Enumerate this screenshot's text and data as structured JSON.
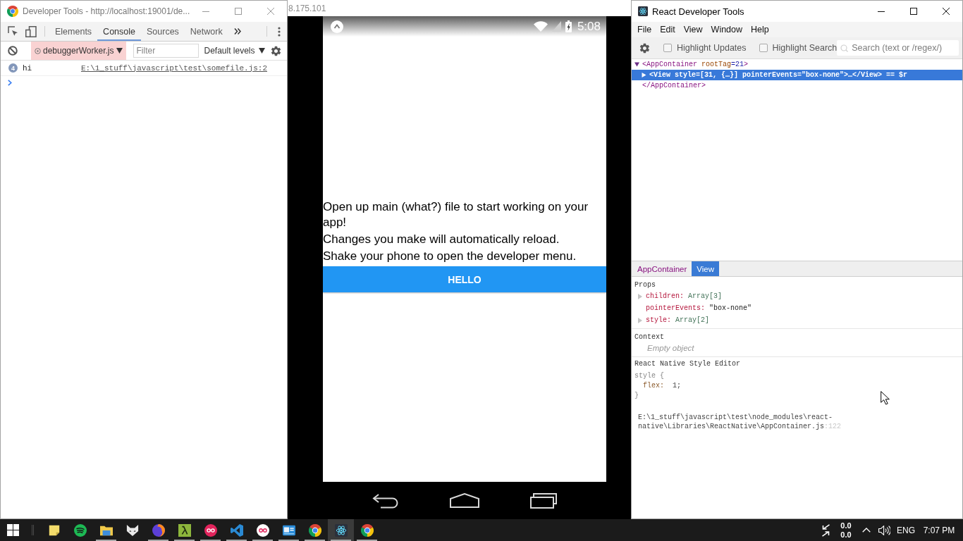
{
  "devtools": {
    "title": "Developer Tools - http://localhost:19001/de...",
    "tabs": [
      {
        "label": "Elements",
        "selected": false
      },
      {
        "label": "Console",
        "selected": true
      },
      {
        "label": "Sources",
        "selected": false
      },
      {
        "label": "Network",
        "selected": false
      }
    ],
    "console_toolbar": {
      "context": "debuggerWorker.js",
      "filter_placeholder": "Filter",
      "levels": "Default levels"
    },
    "messages": [
      {
        "count": "4",
        "text": "hi",
        "source": "E:\\1_stuff\\javascript\\test\\somefile.js:2"
      }
    ]
  },
  "background_window": {
    "text": "8.175.101"
  },
  "phone": {
    "time": "5:08",
    "lines": [
      "Open up main (what?) file to start working on your app!",
      "Changes you make will automatically reload.",
      "Shake your phone to open the developer menu."
    ],
    "button": "HELLO"
  },
  "react_devtools": {
    "title": "React Developer Tools",
    "menu": [
      "File",
      "Edit",
      "View",
      "Window",
      "Help"
    ],
    "options": [
      {
        "label": "Highlight Updates",
        "checked": false
      },
      {
        "label": "Highlight Search",
        "checked": false
      }
    ],
    "search_placeholder": "Search (text or /regex/)",
    "tree": [
      {
        "expanded": true,
        "selected": false,
        "parts": [
          {
            "kind": "tag",
            "text": "<AppContainer"
          },
          {
            "kind": "attr",
            "text": " rootTag"
          },
          {
            "kind": "value",
            "text": "=21"
          },
          {
            "kind": "tag",
            "text": ">"
          }
        ],
        "close": "</AppContainer>",
        "children": [
          {
            "expanded": false,
            "selected": true,
            "label": "<View style=[31, {…}] pointerEvents=\"box-none\">…</View> == $r"
          }
        ]
      }
    ],
    "inspector_tabs": [
      {
        "label": "AppContainer",
        "selected": false
      },
      {
        "label": "View",
        "selected": true
      }
    ],
    "props": {
      "title": "Props",
      "items": [
        {
          "key": "children:",
          "value": "Array[3]",
          "kind": "object"
        },
        {
          "key": "pointerEvents:",
          "value": "\"box-none\"",
          "kind": "string"
        },
        {
          "key": "style:",
          "value": "Array[2]",
          "kind": "object"
        }
      ]
    },
    "context": {
      "title": "Context",
      "empty": "Empty object"
    },
    "style_editor": {
      "title": "React Native Style Editor",
      "lines": [
        {
          "kind": "open",
          "text": "style {"
        },
        {
          "kind": "rule",
          "property": "flex:",
          "value": "1;"
        },
        {
          "kind": "close",
          "text": "}"
        }
      ]
    },
    "source": {
      "path": "E:\\1_stuff\\javascript\\test\\node_modules\\react-native\\Libraries\\ReactNative\\AppContainer.js",
      "line": ":122"
    }
  },
  "taskbar": {
    "apps": [
      {
        "kind": "note",
        "running": false,
        "selected": false
      },
      {
        "kind": "waves",
        "running": false,
        "selected": false
      },
      {
        "kind": "folder",
        "running": true,
        "selected": false
      },
      {
        "kind": "fox",
        "running": false,
        "selected": false
      },
      {
        "kind": "globe",
        "running": true,
        "selected": false
      },
      {
        "kind": "lambda",
        "running": true,
        "selected": false
      },
      {
        "kind": "rings",
        "running": true,
        "selected": false
      },
      {
        "kind": "code",
        "running": true,
        "selected": false
      },
      {
        "kind": "loop",
        "running": true,
        "selected": false
      },
      {
        "kind": "card",
        "running": true,
        "selected": false
      },
      {
        "kind": "wheel",
        "running": true,
        "selected": false
      },
      {
        "kind": "atom",
        "running": true,
        "selected": true
      },
      {
        "kind": "wheel",
        "running": true,
        "selected": false
      }
    ],
    "tray": {
      "upload": "0.0",
      "download": "0.0",
      "language": "ENG",
      "time": "7:07 PM"
    }
  }
}
